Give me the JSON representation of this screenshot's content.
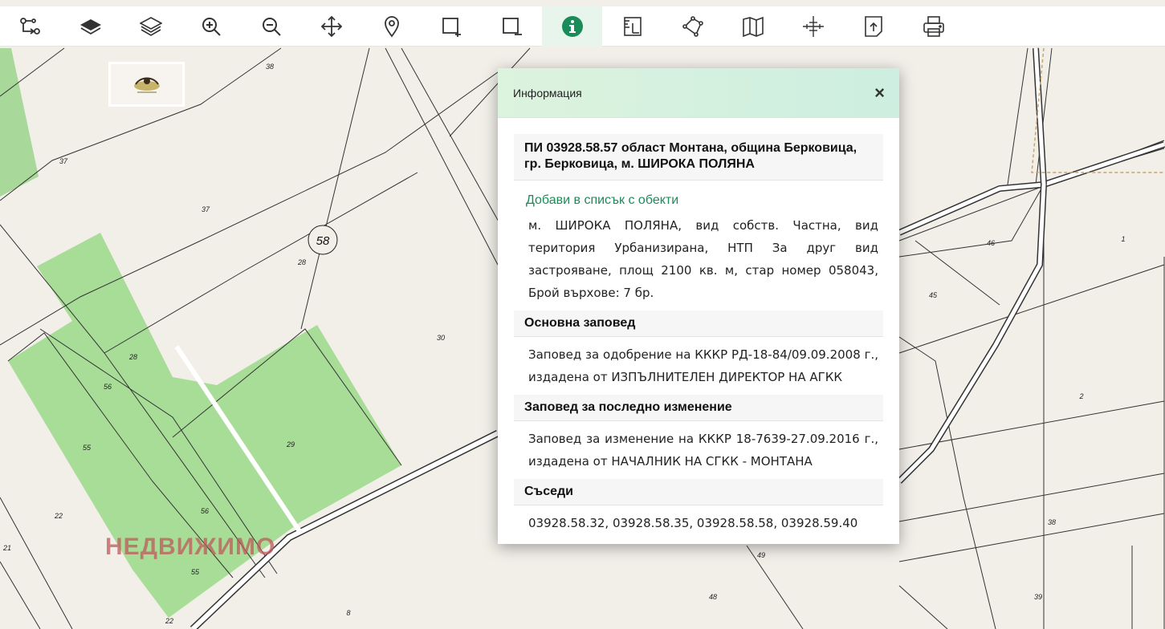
{
  "toolbar": {
    "tools": [
      {
        "id": "route",
        "icon": "route-icon"
      },
      {
        "id": "layers-filled",
        "icon": "layers-filled-icon"
      },
      {
        "id": "layers-outline",
        "icon": "layers-outline-icon"
      },
      {
        "id": "zoom-in",
        "icon": "zoom-in-icon"
      },
      {
        "id": "zoom-out",
        "icon": "zoom-out-icon"
      },
      {
        "id": "pan",
        "icon": "move-icon"
      },
      {
        "id": "location",
        "icon": "location-pin-icon"
      },
      {
        "id": "rect-add",
        "icon": "rectangle-add-icon"
      },
      {
        "id": "rect-remove",
        "icon": "rectangle-remove-icon"
      },
      {
        "id": "info",
        "icon": "info-icon",
        "active": true
      },
      {
        "id": "measure",
        "icon": "ruler-icon"
      },
      {
        "id": "polyline",
        "icon": "polyline-icon"
      },
      {
        "id": "map",
        "icon": "map-icon"
      },
      {
        "id": "coordinates",
        "icon": "crosshair-icon"
      },
      {
        "id": "export",
        "icon": "export-icon"
      },
      {
        "id": "print",
        "icon": "print-icon"
      }
    ],
    "active_color": "#1a8c5a"
  },
  "map": {
    "watermark": "НЕДВИЖИМО",
    "parcel_circle_label": "58",
    "parcel_numbers": [
      "38",
      "37",
      "37",
      "28",
      "28",
      "30",
      "56",
      "55",
      "56",
      "55",
      "22",
      "21",
      "29",
      "22",
      "8",
      "46",
      "45",
      "1",
      "2",
      "38",
      "39",
      "48",
      "49"
    ],
    "colors": {
      "background": "#f2efe9",
      "green": "#a8dd98",
      "lines": "#333333",
      "road": "#ffffff"
    }
  },
  "panel": {
    "title": "Информация",
    "close": "×",
    "parcel_title": "ПИ 03928.58.57 област Монтана, община Берковица, гр. Берковица, м. ШИРОКА ПОЛЯНА",
    "add_link": "Добави в списък с обекти",
    "description": "м. ШИРОКА ПОЛЯНА, вид собств. Частна, вид територия Урбанизирана, НТП За друг вид застрояване, площ 2100 кв. м, стар номер 058043, Брой върхове: 7 бр.",
    "sections": [
      {
        "heading": "Основна заповед",
        "text": "Заповед за одобрение на КККР РД-18-84/09.09.2008 г., издадена от ИЗПЪЛНИТЕЛЕН ДИРЕКТОР НА АГКК"
      },
      {
        "heading": "Заповед за последно изменение",
        "text": "Заповед за изменение на КККР 18-7639-27.09.2016 г., издадена от НАЧАЛНИК НА СГКК - МОНТАНА"
      },
      {
        "heading": "Съседи",
        "text": "03928.58.32, 03928.58.35, 03928.58.58, 03928.59.40"
      }
    ]
  }
}
